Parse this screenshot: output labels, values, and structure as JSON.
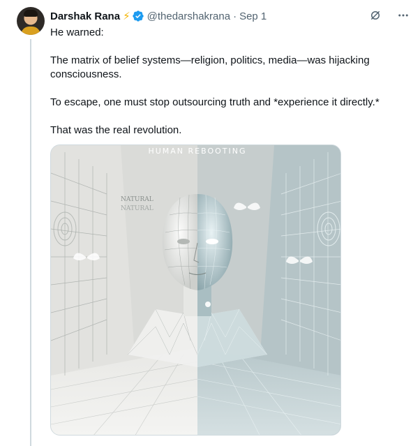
{
  "tweet": {
    "author_name": "Darshak Rana",
    "bolt_emoji": "⚡",
    "handle": "@thedarshakrana",
    "separator": "·",
    "date": "Sep 1",
    "paragraphs": [
      "He warned:",
      "The matrix of belief systems—religion, politics, media—was hijacking consciousness.",
      "To escape, one must stop outsourcing truth and *experience it directly.*",
      "That was the real revolution."
    ],
    "image": {
      "title_text": "HUMAN REBOOTING",
      "side_label_1": "NATURAL",
      "side_label_2": "NATURAL"
    }
  },
  "icons": [
    "verified-badge-icon",
    "grok-icon",
    "more-icon"
  ],
  "colors": {
    "verified": "#1d9bf0",
    "muted_text": "#536471",
    "bolt": "#f4b400"
  }
}
